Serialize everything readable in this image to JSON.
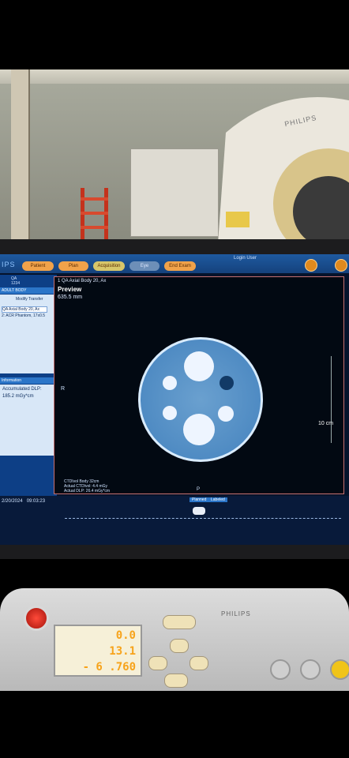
{
  "scanner_brand": "PHILIPS",
  "topbar": {
    "brand": "IPS",
    "tabs": [
      "Patient",
      "Plan",
      "Acquisition",
      "Eye",
      "End Exam"
    ],
    "login": "Login User"
  },
  "left_panel": {
    "patient_id": [
      "QA",
      "1234"
    ],
    "protocol_header": "ADULT BODY",
    "transfer": "Modify Transfer",
    "series": [
      "QA Axial Body 20, Ax",
      "2: ACR Phantom, 17x0.5"
    ],
    "info_header": "Information",
    "dlp_label": "Accumulated DLP:",
    "dlp_value": "185.2 mGy*cm"
  },
  "viewer": {
    "series_title": "1 QA Axial Body 20, Ax",
    "preview": "Preview",
    "fov": "635.5 mm",
    "scale_label": "10 cm",
    "left_orientation": "R",
    "bottom_orientation": "P",
    "dose_lines": [
      "CTDIvol Body 32cm",
      "Actual CTDIvol: 4.4 mGy",
      "Actual DLP: 26.4 mGy*cm"
    ]
  },
  "bottom": {
    "date": "2/20/2024",
    "time": "09:03:23",
    "timeline_labels": [
      "Planned",
      "Labeled"
    ]
  },
  "console": {
    "brand": "PHILIPS",
    "lcd_rows": [
      "0.0",
      "13.1",
      "- 6 .760"
    ]
  }
}
